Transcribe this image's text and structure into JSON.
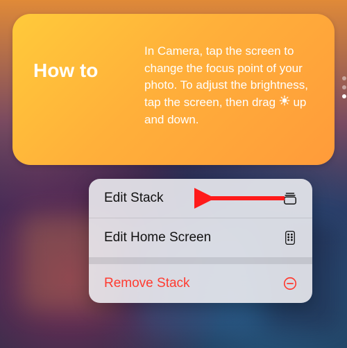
{
  "widget": {
    "title": "How to",
    "body_pre": "In Camera, tap the screen to change the focus point of your photo. To adjust the brightness, tap the screen, then drag ",
    "body_post": " up and down.",
    "sun_icon": "sun-icon"
  },
  "pagination": {
    "total": 3,
    "active_index": 2
  },
  "menu": {
    "items": [
      {
        "label": "Edit Stack",
        "icon": "stack-icon",
        "destructive": false
      },
      {
        "label": "Edit Home Screen",
        "icon": "apps-icon",
        "destructive": false
      },
      {
        "label": "Remove Stack",
        "icon": "minus-circle-icon",
        "destructive": true
      }
    ]
  },
  "annotation": {
    "arrow_target": "Edit Stack"
  },
  "colors": {
    "widget_gradient_start": "#ffca3a",
    "widget_gradient_end": "#ff9b3a",
    "destructive": "#ff3b30"
  }
}
